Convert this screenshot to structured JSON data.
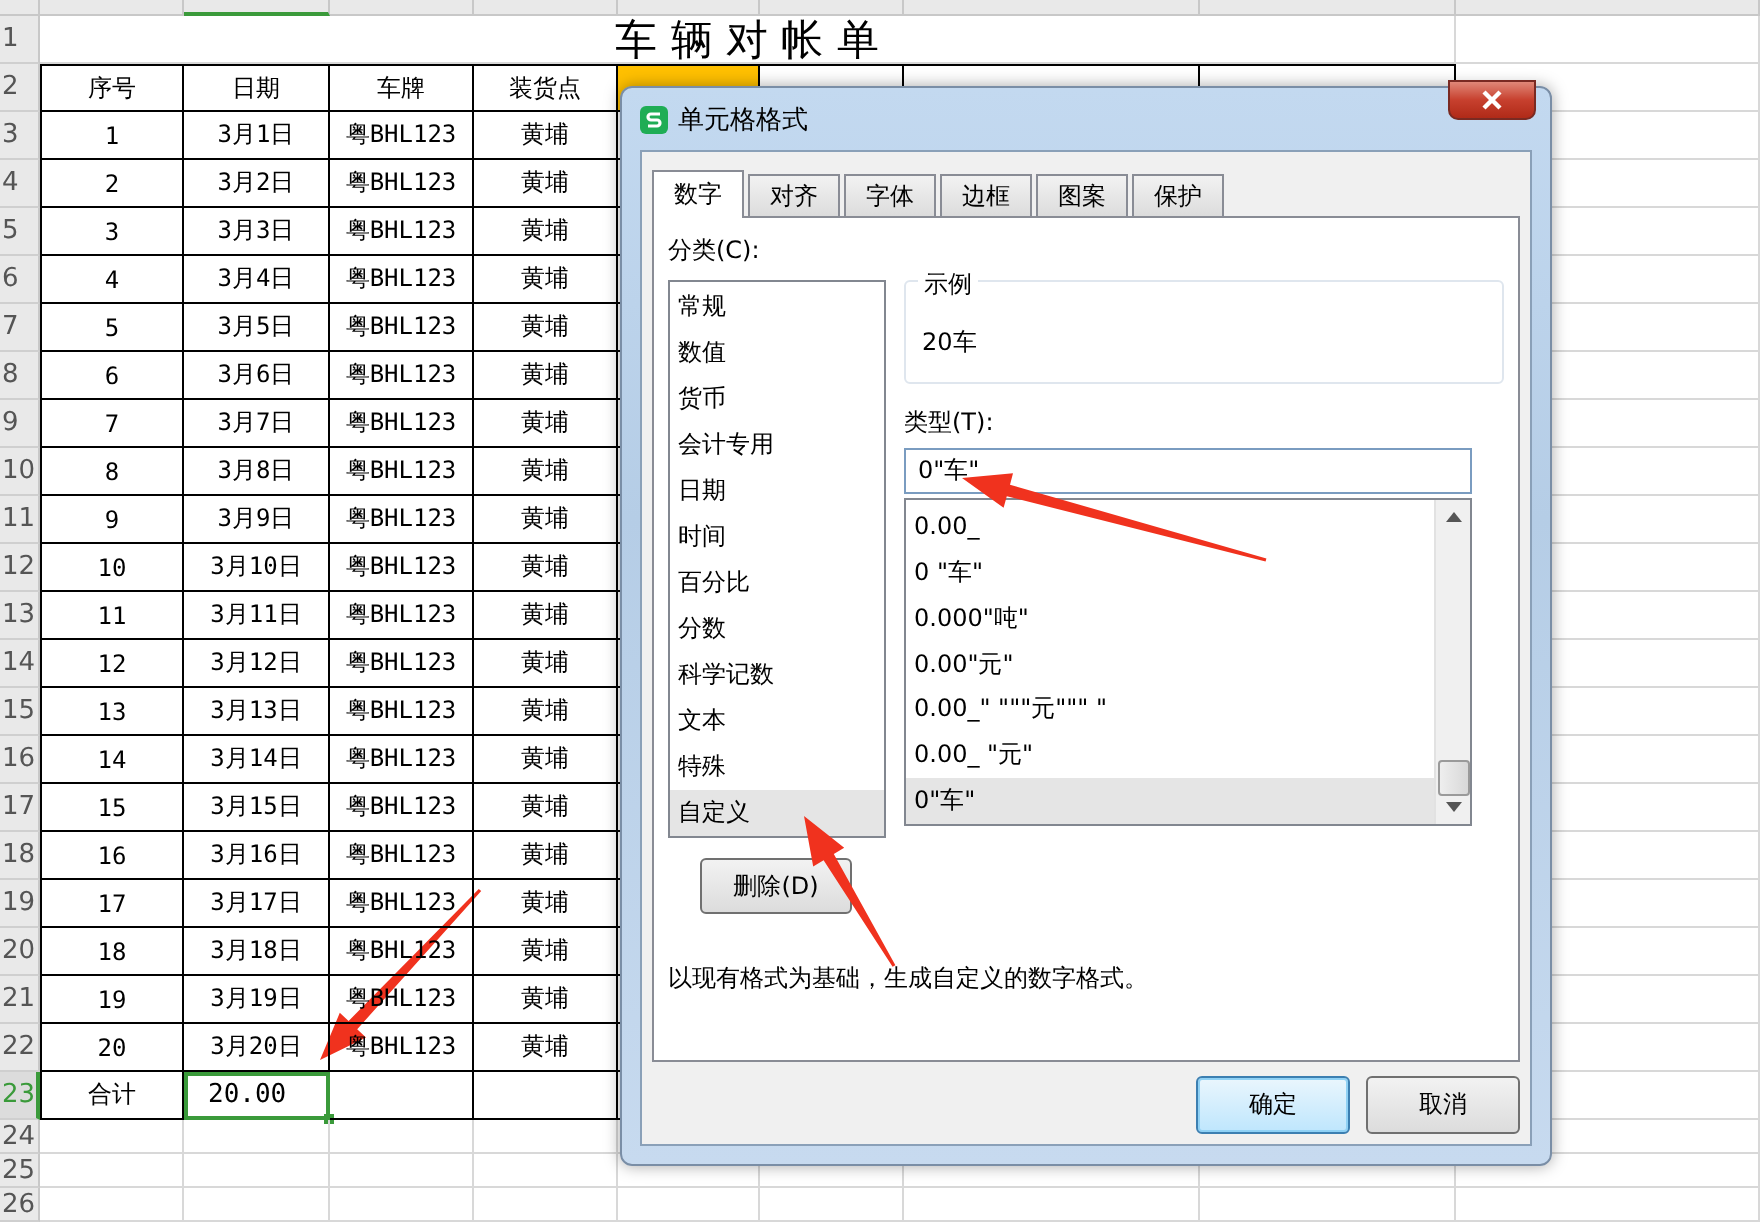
{
  "sheet": {
    "row_headers": [
      {
        "label": "1",
        "selected": false
      },
      {
        "label": "2",
        "selected": false
      },
      {
        "label": "3",
        "selected": false
      },
      {
        "label": "4",
        "selected": false
      },
      {
        "label": "5",
        "selected": false
      },
      {
        "label": "6",
        "selected": false
      },
      {
        "label": "7",
        "selected": false
      },
      {
        "label": "8",
        "selected": false
      },
      {
        "label": "9",
        "selected": false
      },
      {
        "label": "10",
        "selected": false
      },
      {
        "label": "11",
        "selected": false
      },
      {
        "label": "12",
        "selected": false
      },
      {
        "label": "13",
        "selected": false
      },
      {
        "label": "14",
        "selected": false
      },
      {
        "label": "15",
        "selected": false
      },
      {
        "label": "16",
        "selected": false
      },
      {
        "label": "17",
        "selected": false
      },
      {
        "label": "18",
        "selected": false
      },
      {
        "label": "19",
        "selected": false
      },
      {
        "label": "20",
        "selected": false
      },
      {
        "label": "21",
        "selected": false
      },
      {
        "label": "22",
        "selected": false
      },
      {
        "label": "23",
        "selected": true
      },
      {
        "label": "24",
        "selected": false
      },
      {
        "label": "25",
        "selected": false
      },
      {
        "label": "26",
        "selected": false
      }
    ],
    "title": "车 辆 对 帐 单",
    "columns": [
      {
        "label": "序号",
        "highlighted": false
      },
      {
        "label": "日期",
        "highlighted": false
      },
      {
        "label": "车牌",
        "highlighted": false
      },
      {
        "label": "装货点",
        "highlighted": false
      },
      {
        "highlighted": true
      },
      {
        "highlighted": false
      },
      {
        "highlighted": false
      },
      {
        "highlighted": false
      }
    ],
    "rows": [
      {
        "seq": "1",
        "date": "3月1日",
        "plate": "粤BHL123",
        "load_point": "黄埔"
      },
      {
        "seq": "2",
        "date": "3月2日",
        "plate": "粤BHL123",
        "load_point": "黄埔"
      },
      {
        "seq": "3",
        "date": "3月3日",
        "plate": "粤BHL123",
        "load_point": "黄埔"
      },
      {
        "seq": "4",
        "date": "3月4日",
        "plate": "粤BHL123",
        "load_point": "黄埔"
      },
      {
        "seq": "5",
        "date": "3月5日",
        "plate": "粤BHL123",
        "load_point": "黄埔"
      },
      {
        "seq": "6",
        "date": "3月6日",
        "plate": "粤BHL123",
        "load_point": "黄埔"
      },
      {
        "seq": "7",
        "date": "3月7日",
        "plate": "粤BHL123",
        "load_point": "黄埔"
      },
      {
        "seq": "8",
        "date": "3月8日",
        "plate": "粤BHL123",
        "load_point": "黄埔"
      },
      {
        "seq": "9",
        "date": "3月9日",
        "plate": "粤BHL123",
        "load_point": "黄埔"
      },
      {
        "seq": "10",
        "date": "3月10日",
        "plate": "粤BHL123",
        "load_point": "黄埔"
      },
      {
        "seq": "11",
        "date": "3月11日",
        "plate": "粤BHL123",
        "load_point": "黄埔"
      },
      {
        "seq": "12",
        "date": "3月12日",
        "plate": "粤BHL123",
        "load_point": "黄埔"
      },
      {
        "seq": "13",
        "date": "3月13日",
        "plate": "粤BHL123",
        "load_point": "黄埔"
      },
      {
        "seq": "14",
        "date": "3月14日",
        "plate": "粤BHL123",
        "load_point": "黄埔"
      },
      {
        "seq": "15",
        "date": "3月15日",
        "plate": "粤BHL123",
        "load_point": "黄埔"
      },
      {
        "seq": "16",
        "date": "3月16日",
        "plate": "粤BHL123",
        "load_point": "黄埔"
      },
      {
        "seq": "17",
        "date": "3月17日",
        "plate": "粤BHL123",
        "load_point": "黄埔"
      },
      {
        "seq": "18",
        "date": "3月18日",
        "plate": "粤BHL123",
        "load_point": "黄埔"
      },
      {
        "seq": "19",
        "date": "3月19日",
        "plate": "粤BHL123",
        "load_point": "黄埔"
      },
      {
        "seq": "20",
        "date": "3月20日",
        "plate": "粤BHL123",
        "load_point": "黄埔"
      }
    ],
    "total": {
      "label": "合计",
      "value": "20.00",
      "selected": true
    }
  },
  "dialog": {
    "title": "单元格格式",
    "tabs": [
      {
        "label": "数字",
        "selected": true
      },
      {
        "label": "对齐",
        "selected": false
      },
      {
        "label": "字体",
        "selected": false
      },
      {
        "label": "边框",
        "selected": false
      },
      {
        "label": "图案",
        "selected": false
      },
      {
        "label": "保护",
        "selected": false
      }
    ],
    "category_label": "分类(C):",
    "categories": [
      {
        "label": "常规",
        "selected": false
      },
      {
        "label": "数值",
        "selected": false
      },
      {
        "label": "货币",
        "selected": false
      },
      {
        "label": "会计专用",
        "selected": false
      },
      {
        "label": "日期",
        "selected": false
      },
      {
        "label": "时间",
        "selected": false
      },
      {
        "label": "百分比",
        "selected": false
      },
      {
        "label": "分数",
        "selected": false
      },
      {
        "label": "科学记数",
        "selected": false
      },
      {
        "label": "文本",
        "selected": false
      },
      {
        "label": "特殊",
        "selected": false
      },
      {
        "label": "自定义",
        "selected": true
      }
    ],
    "sample_label": "示例",
    "sample": "20车",
    "type_label": "类型(T):",
    "type_value": "0\"车\"",
    "formats": [
      {
        "label": "0.00_",
        "selected": false
      },
      {
        "label": "0  \"车\"",
        "selected": false
      },
      {
        "label": "0.000\"吨\"",
        "selected": false
      },
      {
        "label": "0.00\"元\"",
        "selected": false
      },
      {
        "label": "0.00_\"  \"\"\"元\"\"\"  \"",
        "selected": false
      },
      {
        "label": "0.00_ \"元\"",
        "selected": false
      },
      {
        "label": "0\"车\"",
        "selected": true
      }
    ],
    "delete_button": "删除(D)",
    "description": "以现有格式为基础，生成自定义的数字格式。",
    "ok_button": "确定",
    "cancel_button": "取消"
  }
}
